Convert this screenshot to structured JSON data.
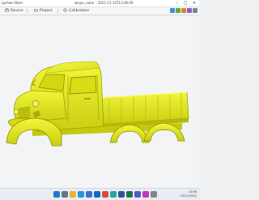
{
  "window": {
    "app_title": "Lychee Slicer",
    "document_title": "wispo_cabin – 2021-11-10T13:06:09",
    "minimize": "–",
    "maximize": "□",
    "close": "×"
  },
  "tabs": [
    {
      "label": "Device",
      "icon": "printer-icon"
    },
    {
      "label": "Project",
      "icon": "folder-icon"
    },
    {
      "label": "Calibration",
      "icon": "calibration-icon"
    }
  ],
  "toolbar_icons": [
    "cube-icon",
    "layers-icon",
    "share-icon",
    "user-icon",
    "settings-icon"
  ],
  "model": {
    "name": "truck-model",
    "color": "#e6ec16",
    "shade": "#b8bd0c",
    "dark": "#8c9006"
  },
  "taskbar": {
    "apps": [
      "start-icon",
      "search-icon",
      "files-icon",
      "edge-icon",
      "store-icon",
      "mail-icon",
      "chrome-icon",
      "slicer-icon",
      "word-icon",
      "excel-icon",
      "teams-icon",
      "photos-icon",
      "settings-icon"
    ],
    "time": "13:06",
    "date": "10/11/2021"
  }
}
